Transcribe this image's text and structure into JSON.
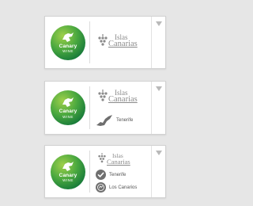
{
  "colors": {
    "badge_green_light": "#8cc63f",
    "badge_green_dark": "#1e8a3e",
    "grey_text": "#8a8a8a",
    "background": "#e6e6e6"
  },
  "cards": [
    {
      "logo": {
        "name": "Canary",
        "sub": "WINE"
      },
      "islas": {
        "line1": "Islas",
        "line2": "Canarias"
      },
      "places": []
    },
    {
      "logo": {
        "name": "Canary",
        "sub": "WINE"
      },
      "islas": {
        "line1": "Islas",
        "line2": "Canarias"
      },
      "places": [
        {
          "icon": "tenerife-island-icon",
          "label": "Tenerife"
        }
      ]
    },
    {
      "logo": {
        "name": "Canary",
        "sub": "WINE"
      },
      "islas": {
        "line1": "Islas",
        "line2": "Canarias"
      },
      "places": [
        {
          "icon": "check-seal-icon",
          "label": "Tenerife"
        },
        {
          "icon": "round-seal-icon",
          "label": "Los Canarios"
        }
      ]
    }
  ]
}
